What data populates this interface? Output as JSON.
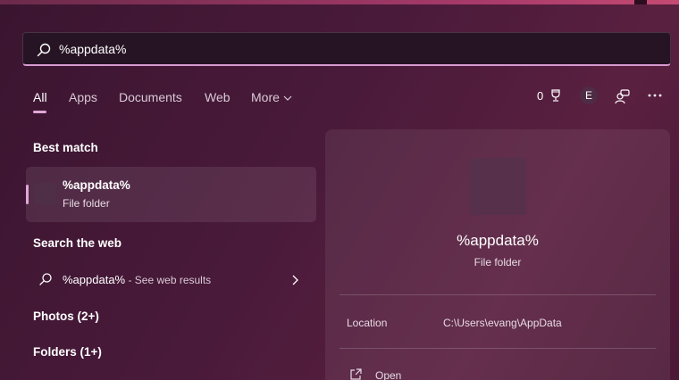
{
  "search": {
    "query": "%appdata%"
  },
  "tabs": [
    {
      "label": "All"
    },
    {
      "label": "Apps"
    },
    {
      "label": "Documents"
    },
    {
      "label": "Web"
    },
    {
      "label": "More"
    }
  ],
  "toolbar": {
    "rewards_count": "0",
    "account_initial": "E",
    "icons": [
      "rewards-trophy-icon",
      "account-avatar",
      "switch-accounts-icon",
      "more-options-icon"
    ]
  },
  "best_match": {
    "section_title": "Best match",
    "name": "%appdata%",
    "type": "File folder"
  },
  "search_web": {
    "section_title": "Search the web",
    "query": "%appdata%",
    "suffix": " - See web results"
  },
  "groups": [
    {
      "label": "Photos (2+)"
    },
    {
      "label": "Folders (1+)"
    }
  ],
  "preview": {
    "name": "%appdata%",
    "type": "File folder",
    "location_label": "Location",
    "location_value": "C:\\Users\\evang\\AppData",
    "actions": [
      {
        "label": "Open",
        "icon": "open-external-icon"
      }
    ]
  },
  "colors": {
    "accent": "#e2a6d8",
    "background": "#4a1a3a",
    "search_bg": "#261424"
  }
}
